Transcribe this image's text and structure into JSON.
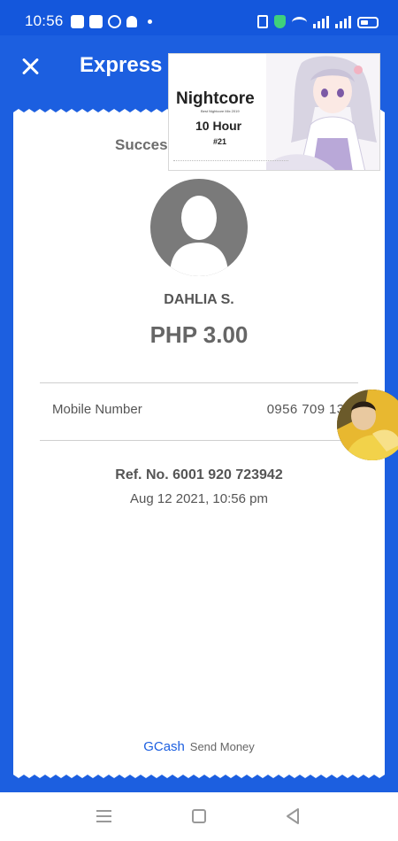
{
  "status_bar": {
    "time": "10:56",
    "left_icons": [
      "app-icon",
      "facebook-icon",
      "messenger-icon",
      "bell-icon",
      "dot-icon"
    ],
    "right_icons": [
      "vibrate-icon",
      "shield-icon",
      "wifi-icon",
      "signal-icon",
      "signal-icon",
      "battery-icon"
    ]
  },
  "header": {
    "title": "Express Send",
    "close_icon": "close-icon",
    "background_color": "#1c5fe0"
  },
  "receipt": {
    "status_text": "Successfully sent to",
    "recipient": {
      "name": "DAHLIA S.",
      "avatar_icon": "person-silhouette-icon"
    },
    "amount": "PHP 3.00",
    "details": [
      {
        "label": "Mobile Number",
        "value": "0956 709 1397"
      }
    ],
    "reference": "Ref. No. 6001 920 723942",
    "date": "Aug 12 2021, 10:56 pm",
    "footer": {
      "brand": "GCash",
      "service": "Send Money"
    }
  },
  "pip_overlay": {
    "title": "Nightcore",
    "subtitle": "Best Nightcore Mix 2019",
    "duration": "10 Hour",
    "episode": "#21"
  },
  "chat_head": {
    "icon": "chat-head-avatar"
  },
  "nav_bar": {
    "items": [
      "recents-icon",
      "home-icon",
      "back-icon"
    ]
  },
  "colors": {
    "brand_blue": "#1c5fe0",
    "text_gray": "#555555",
    "avatar_gray": "#7a7a7a"
  }
}
